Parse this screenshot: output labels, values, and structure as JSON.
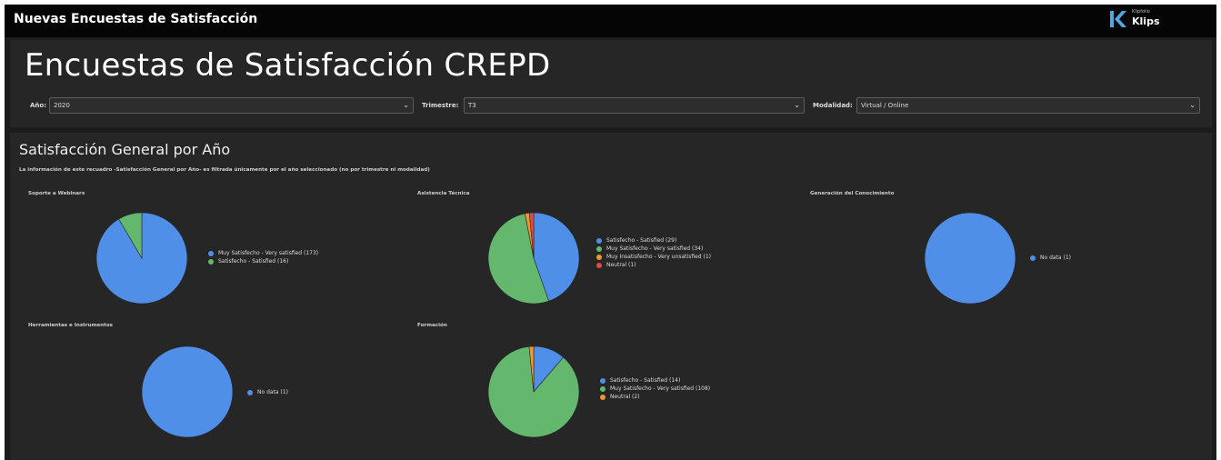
{
  "topbar": {
    "title": "Nuevas Encuestas de Satisfacción"
  },
  "brand": {
    "small": "Klipfolio",
    "name": "Klips"
  },
  "header": {
    "page_title": "Encuestas de Satisfacción CREPD",
    "filters": [
      {
        "label": "Año:",
        "value": "2020"
      },
      {
        "label": "Trimestre:",
        "value": "T3"
      },
      {
        "label": "Modalidad:",
        "value": "Virtual / Online"
      }
    ]
  },
  "section": {
    "title": "Satisfacción General por Año",
    "note": "La información de este recuadro -Satisfacción General por Año- es filtrada únicamente por el año seleccionado (no por trimestre ni modalidad)"
  },
  "colors": {
    "blue": "#4f8fe8",
    "green": "#63b86e",
    "orange": "#f0962c",
    "red": "#e04b48"
  },
  "chart_data": [
    {
      "type": "pie",
      "title": "Soporte a Webinars",
      "series": [
        {
          "label": "Muy Satisfecho - Very satisfied (173)",
          "value": 173,
          "color": "#4f8fe8"
        },
        {
          "label": "Satisfecho - Satisfied (16)",
          "value": 16,
          "color": "#63b86e"
        }
      ]
    },
    {
      "type": "pie",
      "title": "Asistencia Técnica",
      "series": [
        {
          "label": "Satisfecho - Satisfied (29)",
          "value": 29,
          "color": "#4f8fe8"
        },
        {
          "label": "Muy Satisfecho - Very satisfied (34)",
          "value": 34,
          "color": "#63b86e"
        },
        {
          "label": "Muy Insatisfecho - Very unsatisfied (1)",
          "value": 1,
          "color": "#f0962c"
        },
        {
          "label": "Neutral (1)",
          "value": 1,
          "color": "#e04b48"
        }
      ]
    },
    {
      "type": "pie",
      "title": "Generación del Conocimiento",
      "series": [
        {
          "label": "No data (1)",
          "value": 1,
          "color": "#4f8fe8"
        }
      ]
    },
    {
      "type": "pie",
      "title": "Herramientas e Instrumentos",
      "series": [
        {
          "label": "No data (1)",
          "value": 1,
          "color": "#4f8fe8"
        }
      ]
    },
    {
      "type": "pie",
      "title": "Formación",
      "series": [
        {
          "label": "Satisfecho - Satisfied (14)",
          "value": 14,
          "color": "#4f8fe8"
        },
        {
          "label": "Muy Satisfecho - Very satisfied (108)",
          "value": 108,
          "color": "#63b86e"
        },
        {
          "label": "Neutral (2)",
          "value": 2,
          "color": "#f0962c"
        }
      ]
    }
  ]
}
